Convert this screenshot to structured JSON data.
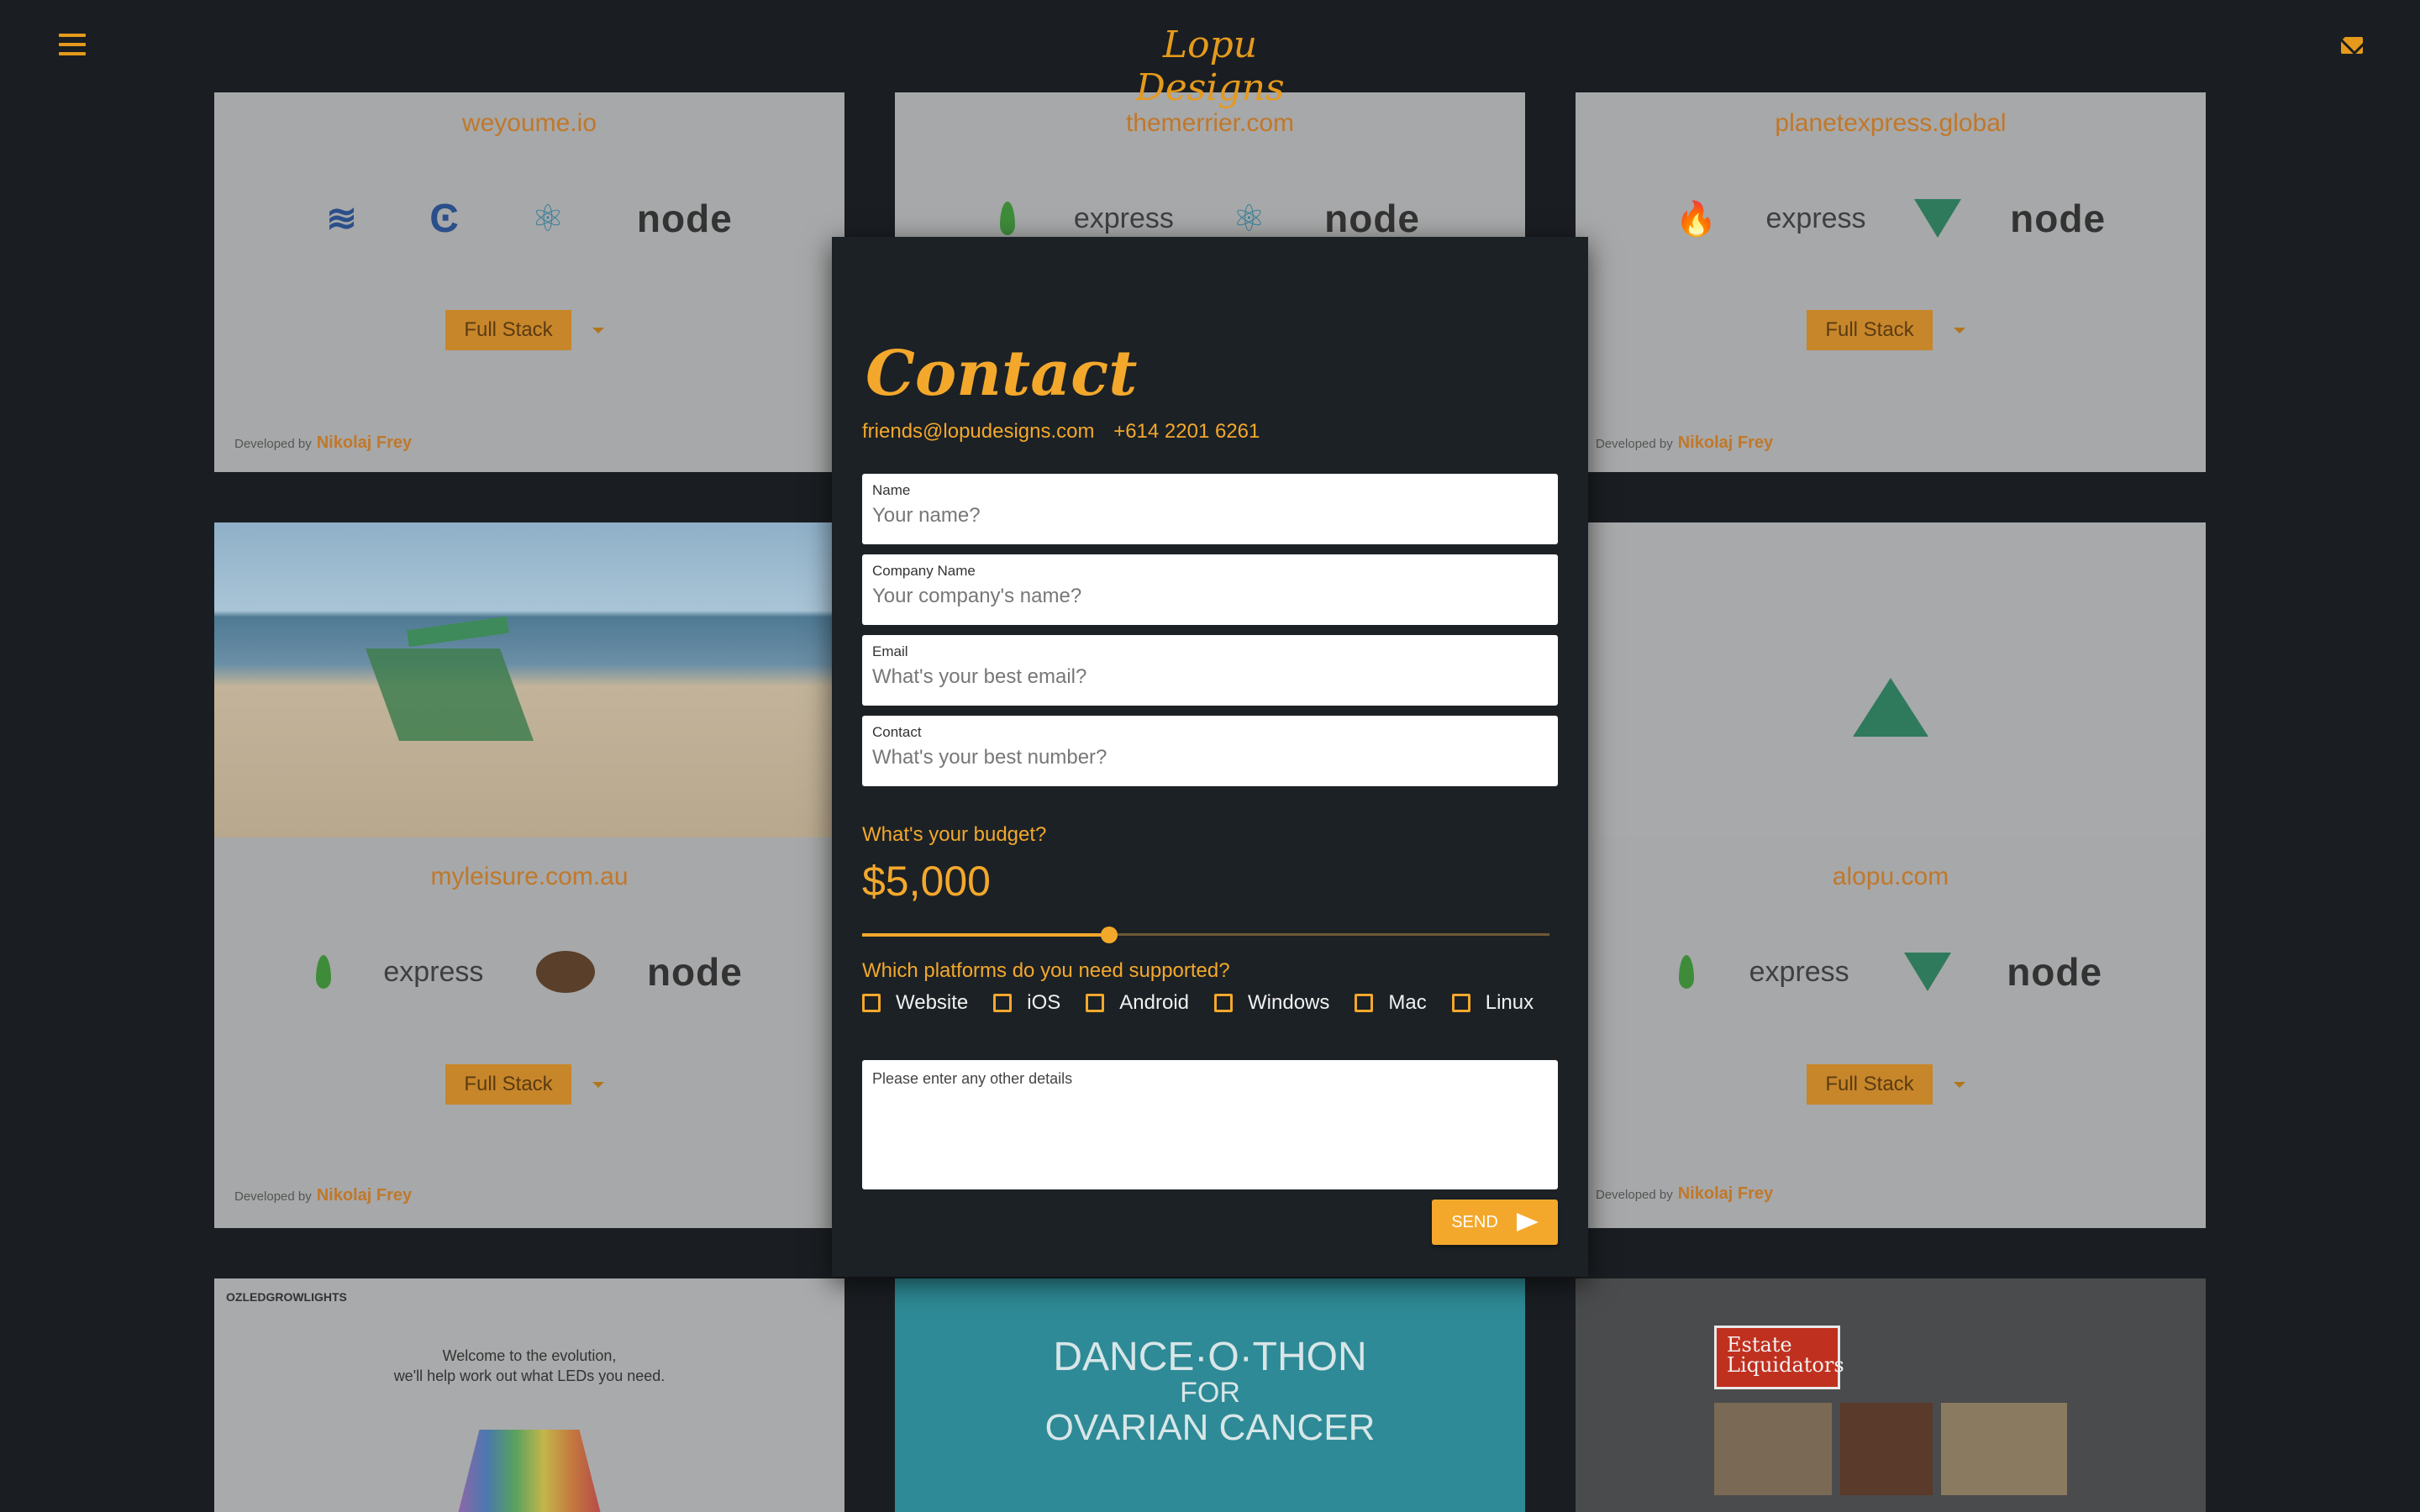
{
  "header": {
    "brand": "Lopu Designs",
    "menu_icon": "hamburger-menu-icon",
    "mail_icon": "mail-icon"
  },
  "projects": [
    {
      "title": "weyoume.io",
      "techs": [
        "steem",
        "c",
        "react",
        "node"
      ],
      "stack": "Full Stack",
      "dev_label": "Developed by",
      "dev_name": "Nikolaj Frey"
    },
    {
      "title": "themerrier.com",
      "techs": [
        "mongodb",
        "express",
        "react",
        "node"
      ]
    },
    {
      "title": "planetexpress.global",
      "techs": [
        "firebase",
        "express",
        "vue",
        "node"
      ],
      "stack": "Full Stack",
      "dev_label": "Developed by",
      "dev_name": "Nikolaj Frey"
    },
    {
      "title": "myleisure.com.au",
      "techs": [
        "mongodb",
        "express",
        "pug",
        "node"
      ],
      "stack": "Full Stack",
      "dev_label": "Developed by",
      "dev_name": "Nikolaj Frey",
      "screenshot": "beach lounger screenshot"
    },
    {
      "title": "alopu.com",
      "techs": [
        "mongodb",
        "express",
        "vue",
        "node"
      ],
      "stack": "Full Stack",
      "dev_label": "Developed by",
      "dev_name": "Nikolaj Frey",
      "screenshot": "alopu landing screenshot"
    },
    {
      "title": "OZLEDGROWLIGHTS",
      "tagline_1": "Welcome to the evolution,",
      "tagline_2": "we'll help work out what LEDs you need."
    },
    {
      "title_1": "DANCE·O·THON",
      "title_2": "FOR",
      "title_3": "OVARIAN CANCER"
    },
    {
      "title_1": "Estate",
      "title_2": "Liquidators"
    }
  ],
  "tech_labels": {
    "express": "express",
    "node": "node"
  },
  "modal": {
    "title": "Contact",
    "email": "friends@lopudesigns.com",
    "phone": "+614 2201 6261",
    "fields": [
      {
        "label": "Name",
        "placeholder": "Your name?"
      },
      {
        "label": "Company Name",
        "placeholder": "Your company's name?"
      },
      {
        "label": "Email",
        "placeholder": "What's your best email?"
      },
      {
        "label": "Contact",
        "placeholder": "What's your best number?"
      }
    ],
    "budget_question": "What's your budget?",
    "budget_value": "$5,000",
    "budget_slider_fraction": 0.36,
    "platforms_question": "Which platforms do you need supported?",
    "platforms": [
      "Website",
      "iOS",
      "Android",
      "Windows",
      "Mac",
      "Linux"
    ],
    "details_placeholder": "Please enter any other details",
    "send_label": "SEND",
    "send_icon": "send-icon"
  },
  "colors": {
    "accent": "#f3a82c",
    "background": "#1a1e22",
    "modal": "#1c2125"
  }
}
